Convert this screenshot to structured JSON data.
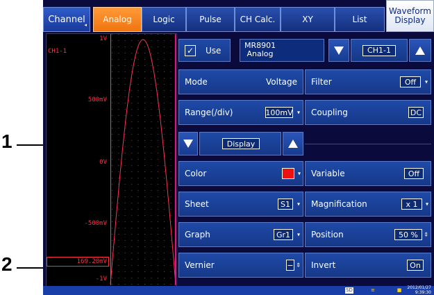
{
  "tabs": [
    {
      "label": "Channel"
    },
    {
      "label": "Analog"
    },
    {
      "label": "Logic"
    },
    {
      "label": "Pulse"
    },
    {
      "label": "CH Calc."
    },
    {
      "label": "XY"
    },
    {
      "label": "List"
    },
    {
      "label": "Waveform\nDisplay"
    }
  ],
  "waveform": {
    "channel": "CH1-1",
    "scale": [
      "1V",
      "500mV",
      "0V",
      "-500mV",
      "-1V"
    ],
    "vernier_value": "169.20mV",
    "trace_color": "#ff3355"
  },
  "settings": {
    "use_label": "Use",
    "use_checked": "✓",
    "module": "MR8901\n Analog",
    "channel": "CH1-1",
    "mode": {
      "label": "Mode",
      "value": "Voltage"
    },
    "filter": {
      "label": "Filter",
      "value": "Off"
    },
    "range": {
      "label": "Range(/div)",
      "value": "100mV"
    },
    "coupling": {
      "label": "Coupling",
      "value": "DC"
    },
    "display_label": "Display",
    "color": {
      "label": "Color",
      "swatch": "#ee1111"
    },
    "variable": {
      "label": "Variable",
      "value": "Off"
    },
    "sheet": {
      "label": "Sheet",
      "value": "S1"
    },
    "magnification": {
      "label": "Magnification",
      "value": "x 1"
    },
    "graph": {
      "label": "Graph",
      "value": "Gr1"
    },
    "position": {
      "label": "Position",
      "value": "50 %"
    },
    "vernier": {
      "label": "Vernier",
      "value": "−"
    },
    "invert": {
      "label": "Invert",
      "value": "On"
    }
  },
  "status": {
    "date": "2012/01/27",
    "time": "9:39:30"
  },
  "callouts": [
    "1",
    "2"
  ]
}
